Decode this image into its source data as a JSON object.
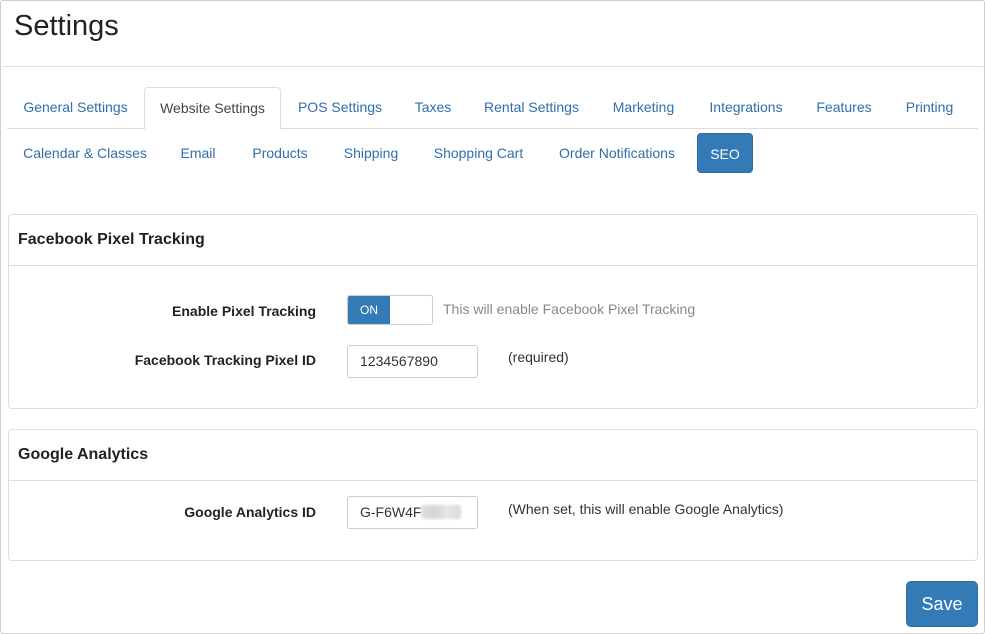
{
  "page": {
    "title": "Settings"
  },
  "tabs": [
    {
      "label": "General Settings",
      "active": false
    },
    {
      "label": "Website Settings",
      "active": true
    },
    {
      "label": "POS Settings",
      "active": false
    },
    {
      "label": "Taxes",
      "active": false
    },
    {
      "label": "Rental Settings",
      "active": false
    },
    {
      "label": "Marketing",
      "active": false
    },
    {
      "label": "Integrations",
      "active": false
    },
    {
      "label": "Features",
      "active": false
    },
    {
      "label": "Printing",
      "active": false
    }
  ],
  "subtabs": [
    {
      "label": "Calendar & Classes",
      "active": false
    },
    {
      "label": "Email",
      "active": false
    },
    {
      "label": "Products",
      "active": false
    },
    {
      "label": "Shipping",
      "active": false
    },
    {
      "label": "Shopping Cart",
      "active": false
    },
    {
      "label": "Order Notifications",
      "active": false
    },
    {
      "label": "SEO",
      "active": true
    }
  ],
  "facebook": {
    "heading": "Facebook Pixel Tracking",
    "enable_label": "Enable Pixel Tracking",
    "toggle_on_label": "ON",
    "toggle_state": "on",
    "enable_help": "This will enable Facebook Pixel Tracking",
    "pixel_id_label": "Facebook Tracking Pixel ID",
    "pixel_id_value": "1234567890",
    "pixel_id_note": "(required)"
  },
  "google": {
    "heading": "Google Analytics",
    "ga_id_label": "Google Analytics ID",
    "ga_id_value": "G-F6W4F",
    "ga_id_note": "(When set, this will enable Google Analytics)"
  },
  "actions": {
    "save_label": "Save"
  },
  "colors": {
    "accent": "#337ab7",
    "link": "#2f6fab",
    "border": "#dddddd"
  }
}
